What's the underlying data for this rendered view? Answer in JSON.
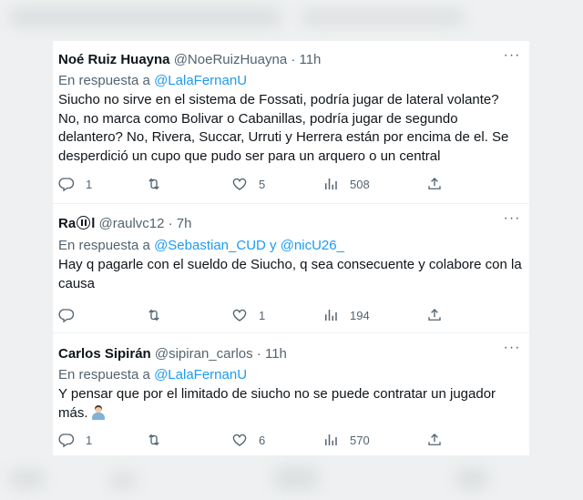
{
  "tweets": [
    {
      "name": "Noé Ruiz Huayna",
      "handle": "@NoeRuizHuayna · 11h",
      "reply_prefix": "En respuesta a ",
      "reply_to": "@LalaFernanU",
      "text": "Siucho no sirve en el sistema de Fossati, podría jugar de lateral volante? No, no marca como Bolivar o Cabanillas, podría jugar de segundo delantero? No, Rivera, Succar, Urruti y Herrera están por encima de el.  Se desperdició un cupo que pudo ser para un arquero o un central",
      "replies": "1",
      "retweets": "",
      "likes": "5",
      "views": "508"
    },
    {
      "name_prefix": "Ra",
      "name_suffix": "l",
      "handle": "@raulvc12 · 7h",
      "reply_prefix": "En respuesta a ",
      "reply_to": "@Sebastian_CUD y @nicU26_",
      "text": "Hay q pagarle con el sueldo de Siucho, q sea consecuente y colabore con la causa",
      "replies": "",
      "retweets": "",
      "likes": "1",
      "views": "194"
    },
    {
      "name": "Carlos Sipirán",
      "handle": "@sipiran_carlos · 11h",
      "reply_prefix": "En respuesta a ",
      "reply_to": "@LalaFernanU",
      "text_line1": "Y pensar que por el limitado de siucho no se puede contratar un jugador",
      "text_line2": "más.",
      "replies": "1",
      "retweets": "",
      "likes": "6",
      "views": "570"
    }
  ],
  "more_label": "···",
  "icons": {
    "reply": "reply-icon",
    "retweet": "retweet-icon",
    "like": "heart-icon",
    "views": "views-icon",
    "share": "share-icon"
  },
  "colors": {
    "link": "#1d9bf0",
    "muted": "#536471",
    "text": "#0f1419"
  }
}
